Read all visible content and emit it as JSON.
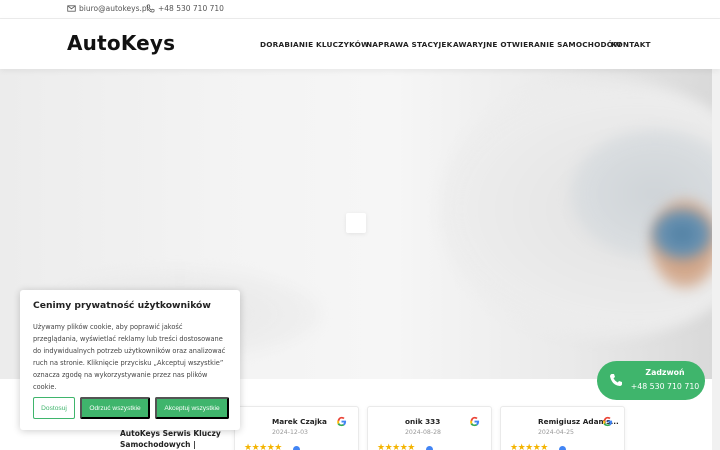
{
  "topbar": {
    "email": "biuro@autokeys.pl",
    "phone": "+48 530 710 710"
  },
  "header": {
    "logo": "AutoKeys",
    "nav": [
      {
        "label": "DORABIANIE KLUCZYKÓW"
      },
      {
        "label": "NAPRAWA STACYJEK"
      },
      {
        "label": "AWARYJNE OTWIERANIE SAMOCHODÓW"
      },
      {
        "label": "KONTAKT"
      }
    ]
  },
  "cookie": {
    "title": "Cenimy prywatność użytkowników",
    "lines": [
      "Używamy plików cookie, aby poprawić jakość",
      "przeglądania, wyświetlać reklamy lub treści dostosowane",
      "do indywidualnych potrzeb użytkowników oraz analizować",
      "ruch na stronie. Kliknięcie przycisku „Akceptuj wszystkie”",
      "oznacza zgodę na wykorzystywanie przez nas plików",
      "cookie."
    ],
    "settings_label": "Dostosuj",
    "reject_label": "Odrzuć wszystkie",
    "accept_label": "Akceptuj wszystkie"
  },
  "call": {
    "label": "Zadzwoń",
    "number": "+48 530 710 710"
  },
  "reviews": {
    "summary_line1": "AutoKeys Serwis Kluczy",
    "summary_line2": "Samochodowych |",
    "items": [
      {
        "name": "Marek Czajka",
        "date": "2024-12-03",
        "stars": "★★★★★"
      },
      {
        "name": "onik 333",
        "date": "2024-08-28",
        "stars": "★★★★★"
      },
      {
        "name": "Remigiusz Adams...",
        "date": "2024-04-25",
        "stars": "★★★★★"
      }
    ]
  },
  "colors": {
    "accent": "#3fb56c",
    "star": "#f4b400"
  }
}
